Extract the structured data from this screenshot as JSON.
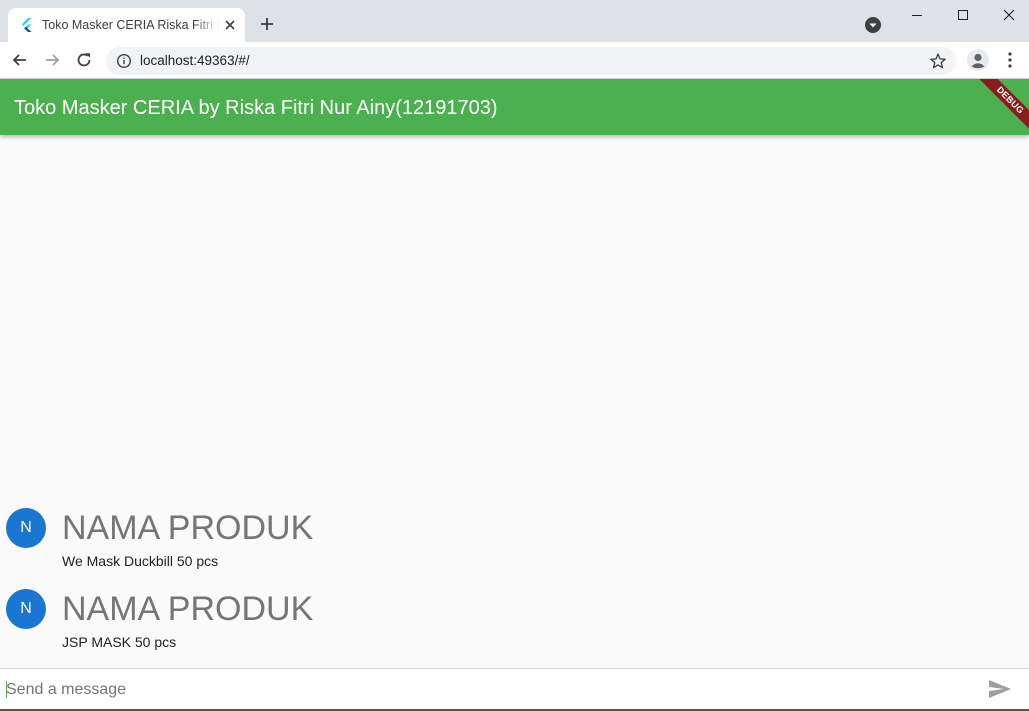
{
  "browser": {
    "tab": {
      "title": "Toko Masker CERIA Riska Fitri Nur Ainy",
      "favicon": "flutter-icon"
    },
    "address_bar": {
      "url": "localhost:49363/#/"
    },
    "icons": {
      "back": "arrow-back-icon",
      "forward": "arrow-forward-icon",
      "reload": "reload-icon",
      "site_info": "info-icon",
      "bookmark": "star-icon",
      "account": "account-icon",
      "menu": "more-vert-icon",
      "new_tab": "plus-icon",
      "tab_search": "chevron-down-icon"
    }
  },
  "app": {
    "title": "Toko Masker CERIA by Riska Fitri Nur Ainy(12191703)",
    "debug_banner": "DEBUG",
    "colors": {
      "app_bar": "#4caf50",
      "avatar": "#1976d2",
      "debug_ribbon": "#8b1a1a"
    }
  },
  "messages": [
    {
      "avatar_initial": "N",
      "title": "NAMA PRODUK",
      "body": "We Mask Duckbill 50 pcs"
    },
    {
      "avatar_initial": "N",
      "title": "NAMA PRODUK",
      "body": "JSP MASK 50 pcs"
    }
  ],
  "composer": {
    "placeholder": "Send a message",
    "value": "",
    "send_icon": "send-icon"
  }
}
